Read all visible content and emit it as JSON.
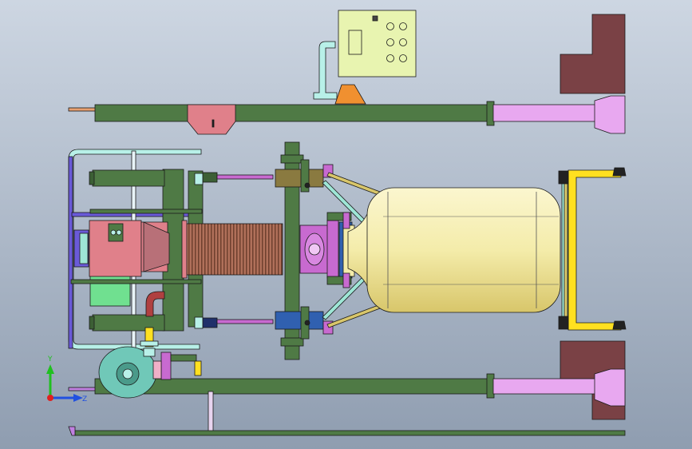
{
  "scene": {
    "background_top": "#cdd6e2",
    "background_bottom": "#8f9db0",
    "outline": "#1a1a1a"
  },
  "colors": {
    "frame_green": "#4f7a45",
    "frame_green_dark": "#3c5f35",
    "light_cyan": "#b8f0e8",
    "pipe_cyan": "#9ee6d6",
    "pink_leg": "#e8a8f0",
    "maroon_block": "#7a4145",
    "tank_yellow": "#f4ecaa",
    "tank_yellow_shade": "#e3d47a",
    "salmon": "#e0808a",
    "copper": "#b0705a",
    "violet": "#c86ad0",
    "blue_violet": "#6a5ad8",
    "yellow_frame": "#ffe020",
    "orange": "#f09030",
    "blue_block": "#3060b0",
    "olive": "#8a7a40",
    "control_box": "#e8f4b0",
    "wheel": "#70c8b8"
  },
  "axis_triad": {
    "y_label": "Y",
    "z_label": "Z",
    "y_color": "#20c020",
    "z_color": "#2050e0",
    "x_color": "#e02020"
  },
  "control_panel": {
    "button_count": 6
  }
}
